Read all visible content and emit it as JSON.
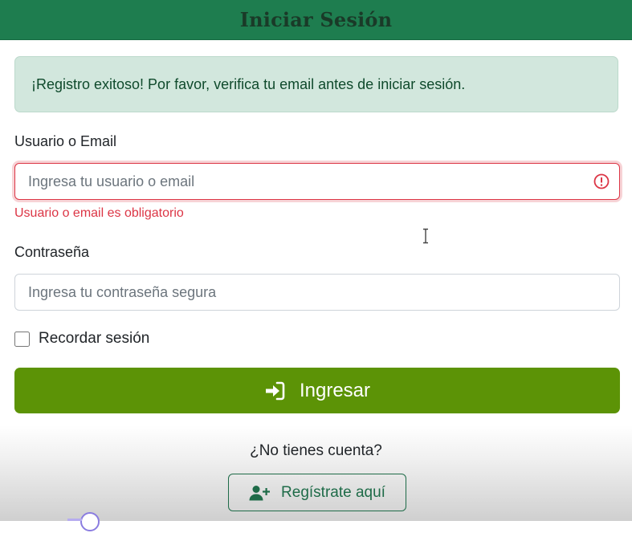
{
  "header": {
    "title": "Iniciar Sesión"
  },
  "alert": {
    "text": "¡Registro exitoso! Por favor, verifica tu email antes de iniciar sesión."
  },
  "form": {
    "username": {
      "label": "Usuario o Email",
      "placeholder": "Ingresa tu usuario o email",
      "value": "",
      "error": "Usuario o email es obligatorio",
      "state": "invalid"
    },
    "password": {
      "label": "Contraseña",
      "placeholder": "Ingresa tu contraseña segura",
      "value": ""
    },
    "remember": {
      "label": "Recordar sesión",
      "checked": false
    },
    "submit": {
      "label": "Ingresar",
      "icon": "sign-in-icon"
    }
  },
  "footer": {
    "prompt": "¿No tienes cuenta?",
    "register": {
      "label": "Regístrate aquí",
      "icon": "user-plus-icon"
    }
  },
  "colors": {
    "header_bg": "#1e7d4f",
    "alert_bg": "#d2e7dd",
    "error": "#dc3545",
    "submit_bg": "#5c9306",
    "register_border": "#1e6b48"
  }
}
